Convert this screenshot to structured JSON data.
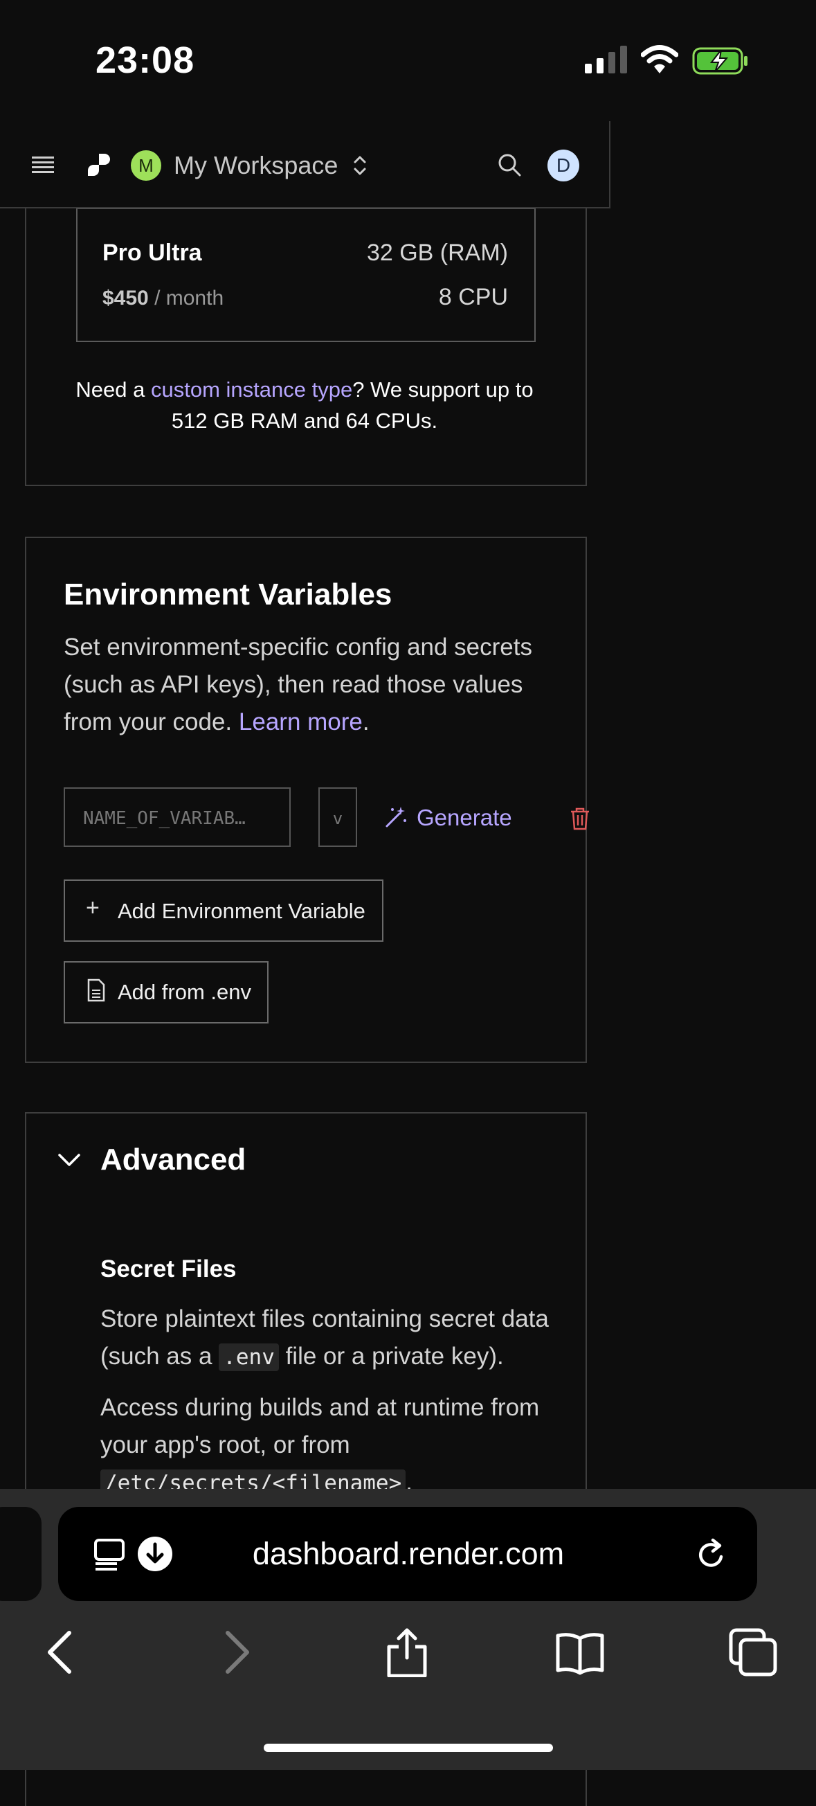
{
  "status_bar": {
    "time": "23:08"
  },
  "header": {
    "workspace_initial": "M",
    "workspace_name": "My Workspace",
    "user_initial": "D"
  },
  "instance": {
    "plan_name": "Pro Ultra",
    "ram": "32 GB (RAM)",
    "price": "$450",
    "price_suffix": " / month",
    "cpu": "8 CPU",
    "note_prefix": "Need a ",
    "note_link": "custom instance type",
    "note_suffix": "? We support up to 512 GB RAM and 64 CPUs."
  },
  "env": {
    "title": "Environment Variables",
    "desc": "Set environment-specific config and secrets (such as API keys), then read those values from your code. ",
    "learn_more": "Learn more",
    "period": ".",
    "key_placeholder": "NAME_OF_VARIAB…",
    "value_placeholder": "v",
    "generate_label": "Generate",
    "add_var_label": "Add Environment Variable",
    "add_env_label": "Add from .env"
  },
  "advanced": {
    "title": "Advanced",
    "secret_files_title": "Secret Files",
    "desc1_prefix": "Store plaintext files containing secret data (such as a ",
    "desc1_code": ".env",
    "desc1_suffix": " file or a private key).",
    "desc2_prefix": "Access during builds and at runtime from your app's root, or from ",
    "desc2_code": "/etc/secrets/<filename>",
    "desc2_suffix": "."
  },
  "browser": {
    "url": "dashboard.render.com"
  },
  "colors": {
    "accent": "#b7a6ff",
    "danger": "#e05a5a",
    "workspace": "#9ee05a"
  }
}
